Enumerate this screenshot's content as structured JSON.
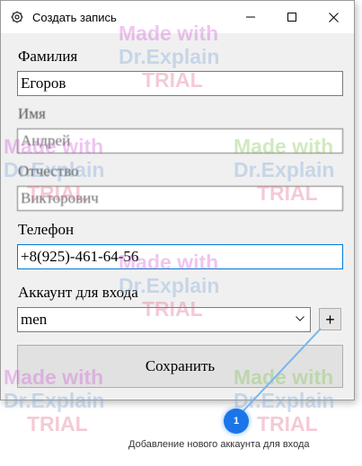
{
  "window": {
    "title": "Создать запись",
    "icon": "gear-icon",
    "controls": [
      "minimize-icon",
      "maximize-icon",
      "close-icon"
    ]
  },
  "form": {
    "last_name": {
      "label": "Фамилия",
      "value": "Егоров"
    },
    "first_name": {
      "label": "Имя",
      "value": "Андрей"
    },
    "patronymic": {
      "label": "Отчество",
      "value": "Викторович"
    },
    "phone": {
      "label": "Телефон",
      "value": "+8(925)-461-64-56"
    },
    "account": {
      "label": "Аккаунт для входа",
      "value": "men",
      "add_label": "+"
    },
    "save_label": "Сохранить"
  },
  "watermark": {
    "line1": "Made with",
    "line2": "Dr.Explain",
    "line3": "TRIAL"
  },
  "callout": {
    "number": "1",
    "text": "Добавление нового аккаунта для входа",
    "color": "#1a75e8"
  },
  "colors": {
    "focus_border": "#0078d7",
    "window_bg": "#f0f0f0"
  }
}
